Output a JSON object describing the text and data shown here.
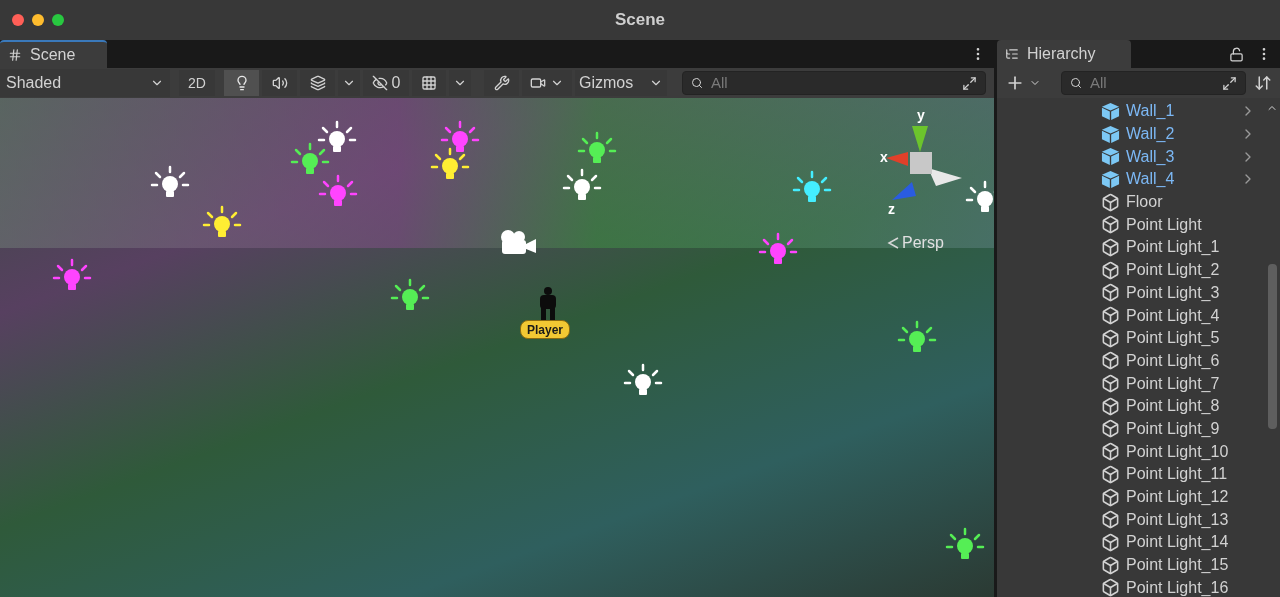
{
  "window": {
    "title": "Scene"
  },
  "scene_panel": {
    "tab": {
      "label": "Scene",
      "selected": true
    },
    "draw_mode": "Shaded",
    "mode_2d": {
      "label": "2D",
      "on": false
    },
    "toggles": [
      {
        "kind": "lighting",
        "on": true
      },
      {
        "kind": "audio",
        "on": false
      },
      {
        "kind": "effects",
        "on": false
      }
    ],
    "hidden_count": "0",
    "gizmos": "Gizmos",
    "search": {
      "placeholder": "All"
    }
  },
  "viewport": {
    "projection": "Persp",
    "axes": [
      "x",
      "y",
      "z"
    ],
    "player_label": "Player",
    "lights": [
      {
        "color": "#ffffff"
      },
      {
        "color": "#ff44ff"
      },
      {
        "color": "#55ee55"
      },
      {
        "color": "#ffee33"
      },
      {
        "color": "#ff44ff"
      },
      {
        "color": "#ffffff"
      },
      {
        "color": "#55ee55"
      },
      {
        "color": "#ffffff"
      },
      {
        "color": "#ffee33"
      },
      {
        "color": "#44eeff"
      },
      {
        "color": "#ff44ff"
      },
      {
        "color": "#ff44ff"
      },
      {
        "color": "#55ee55"
      },
      {
        "color": "#ffffff"
      },
      {
        "color": "#55ee55"
      },
      {
        "color": "#55ee55"
      },
      {
        "color": "#ffffff"
      }
    ]
  },
  "hierarchy": {
    "tab": {
      "label": "Hierarchy",
      "selected": true
    },
    "search": {
      "placeholder": "All"
    },
    "items": [
      {
        "label": "Wall_1",
        "kind": "prefab"
      },
      {
        "label": "Wall_2",
        "kind": "prefab"
      },
      {
        "label": "Wall_3",
        "kind": "prefab"
      },
      {
        "label": "Wall_4",
        "kind": "prefab"
      },
      {
        "label": "Floor",
        "kind": "object"
      },
      {
        "label": "Point Light",
        "kind": "object"
      },
      {
        "label": "Point Light_1",
        "kind": "object"
      },
      {
        "label": "Point Light_2",
        "kind": "object"
      },
      {
        "label": "Point Light_3",
        "kind": "object"
      },
      {
        "label": "Point Light_4",
        "kind": "object"
      },
      {
        "label": "Point Light_5",
        "kind": "object"
      },
      {
        "label": "Point Light_6",
        "kind": "object"
      },
      {
        "label": "Point Light_7",
        "kind": "object"
      },
      {
        "label": "Point Light_8",
        "kind": "object"
      },
      {
        "label": "Point Light_9",
        "kind": "object"
      },
      {
        "label": "Point Light_10",
        "kind": "object"
      },
      {
        "label": "Point Light_11",
        "kind": "object"
      },
      {
        "label": "Point Light_12",
        "kind": "object"
      },
      {
        "label": "Point Light_13",
        "kind": "object"
      },
      {
        "label": "Point Light_14",
        "kind": "object"
      },
      {
        "label": "Point Light_15",
        "kind": "object"
      },
      {
        "label": "Point Light_16",
        "kind": "object"
      }
    ]
  }
}
